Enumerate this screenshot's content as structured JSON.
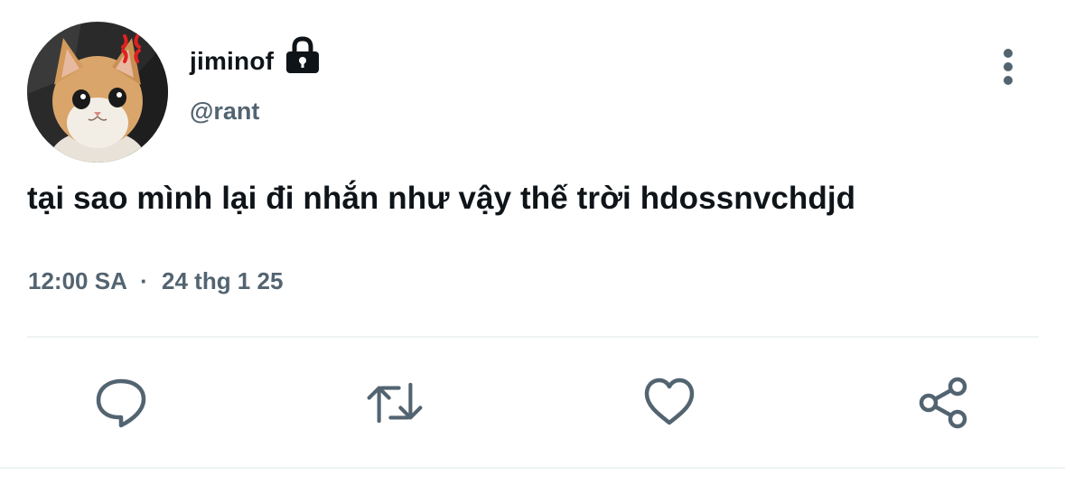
{
  "tweet": {
    "display_name": "jiminof",
    "handle": "@rant",
    "text": "tại sao mình lại đi nhắn như vậy thế trời hdossnvchdjd",
    "time": "12:00 SA",
    "separator": "·",
    "date": "24 thg 1 25",
    "protected_icon": "lock-icon",
    "avatar_description_icon": "cat-avatar"
  },
  "actions": [
    {
      "name": "reply",
      "icon": "speech-bubble-icon"
    },
    {
      "name": "retweet",
      "icon": "retweet-arrows-icon"
    },
    {
      "name": "like",
      "icon": "heart-icon"
    },
    {
      "name": "share",
      "icon": "share-icon"
    }
  ],
  "colors": {
    "primary_text": "#0f1419",
    "secondary_text": "#536471",
    "divider": "#eff3f4",
    "icon": "#536471"
  }
}
